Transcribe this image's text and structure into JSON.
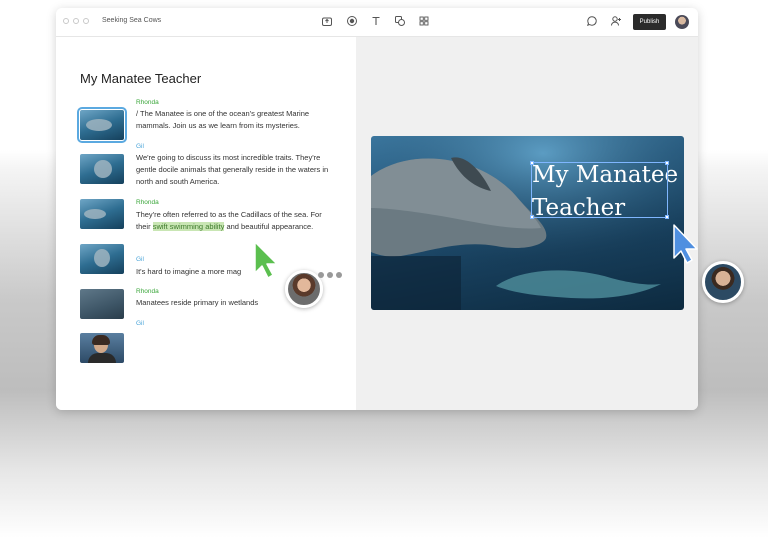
{
  "window": {
    "title": "Seeking Sea Cows",
    "toolbar_icons": [
      "upload-icon",
      "record-icon",
      "text-icon",
      "shapes-icon",
      "grid-icon"
    ],
    "right_icons": [
      "comment-icon",
      "add-user-icon"
    ],
    "publish_label": "Publish"
  },
  "document": {
    "title": "My Manatee Teacher",
    "items": [
      {
        "speaker": "Rhonda",
        "text": "/ The Manatee is one of the ocean's greatest Marine mammals. Join us as we learn from its mysteries."
      },
      {
        "speaker": "Gil",
        "text": "We're going to discuss its most incredible traits. They're gentle docile animals that generally reside in the waters in north and south America."
      },
      {
        "speaker": "Rhonda",
        "text_before": "They're often referred to as the Cadillacs of the sea. For their ",
        "highlight": "swift swimming ability",
        "text_after": " and beautiful appearance."
      },
      {
        "speaker": "Gil",
        "text": "It's hard to imagine a more mag"
      },
      {
        "speaker": "Rhonda",
        "text": "Manatees reside primary in wetlands"
      },
      {
        "speaker": "Gil",
        "text": ""
      }
    ]
  },
  "slide": {
    "title_line1": "My Manatee",
    "title_line2": "Teacher"
  },
  "colors": {
    "speaker_rhonda": "#3aa63a",
    "speaker_gil": "#4aa4d8",
    "highlight": "#c9e6b4",
    "publish_bg": "#2b2b2b",
    "selection": "#7fb6ff"
  }
}
